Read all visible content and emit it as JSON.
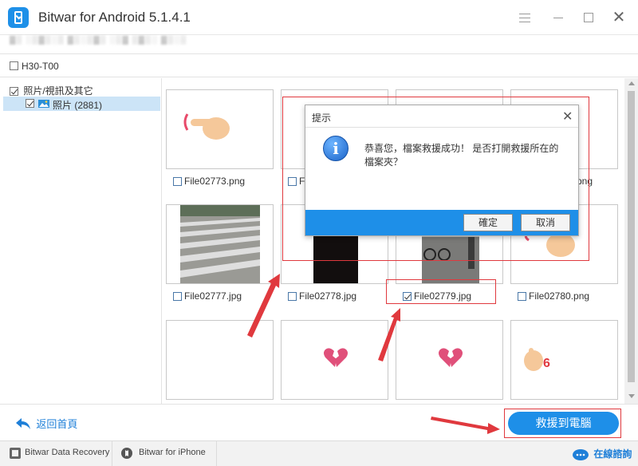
{
  "app": {
    "title": "Bitwar for Android  5.1.4.1",
    "device_path": "▓▒ ░▒▓▒░▒ ▓▒░▒▓▒ ░▒▓ ▒▓▒░ ▓▒░▒",
    "accent_color": "#1e8fe8",
    "highlight_color": "#e0393e"
  },
  "device": {
    "name": "H30-T00",
    "checked": false
  },
  "tree": {
    "root_label": "照片/視訊及其它",
    "child_label": "照片 (2881)"
  },
  "files": [
    {
      "name": "File02773.png",
      "checked": false,
      "thumb": "pointing-hand-emoji"
    },
    {
      "name": "F",
      "checked": false,
      "thumb": "blank"
    },
    {
      "name": "",
      "checked": false,
      "thumb": "blank"
    },
    {
      "name": "png",
      "checked": false,
      "thumb": "blank"
    },
    {
      "name": "File02777.jpg",
      "checked": false,
      "thumb": "crosswalk-photo"
    },
    {
      "name": "File02778.jpg",
      "checked": false,
      "thumb": "dark-photo"
    },
    {
      "name": "File02779.jpg",
      "checked": true,
      "thumb": "street-photo"
    },
    {
      "name": "File02780.png",
      "checked": false,
      "thumb": "hand-emoji"
    },
    {
      "name": "",
      "checked": false,
      "thumb": "blank"
    },
    {
      "name": "",
      "checked": false,
      "thumb": "broken-heart-emoji"
    },
    {
      "name": "",
      "checked": false,
      "thumb": "broken-heart-emoji"
    },
    {
      "name": "",
      "checked": false,
      "thumb": "hand-six-emoji"
    }
  ],
  "bottom": {
    "back_label": "返回首頁",
    "recover_label": "救援到電腦"
  },
  "footer": {
    "data_recovery": "Bitwar Data Recovery",
    "iphone": "Bitwar for iPhone",
    "online_support": "在線諮詢"
  },
  "dialog": {
    "title": "提示",
    "icon": "info-icon",
    "message": "恭喜您，檔案救援成功！ 是否打開救援所在的檔案夾？",
    "ok_label": "確定",
    "cancel_label": "取消"
  }
}
